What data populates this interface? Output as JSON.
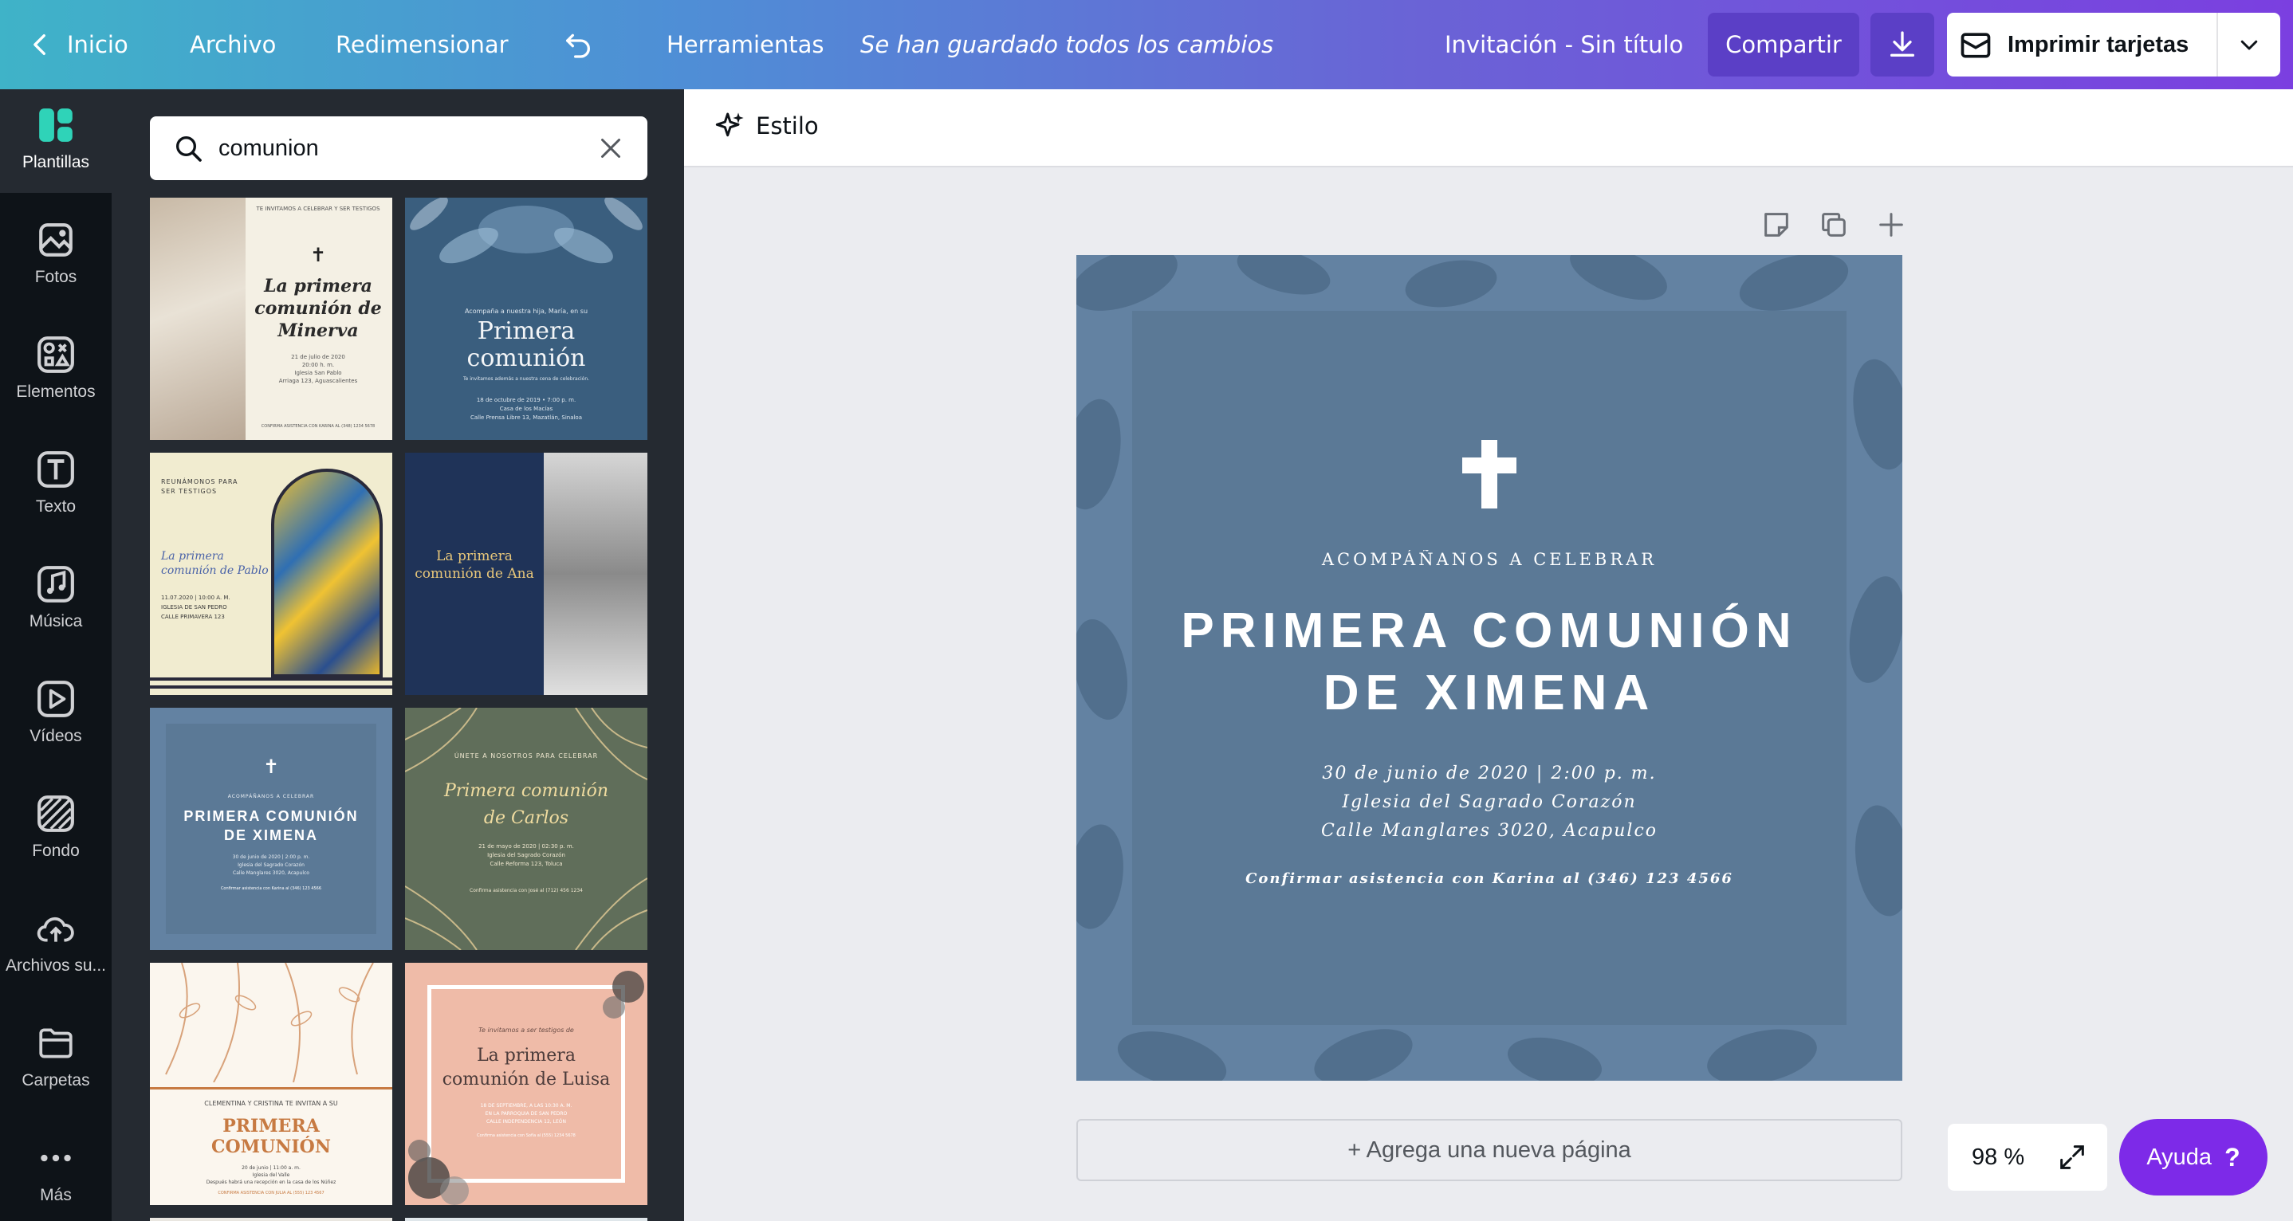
{
  "topbar": {
    "home": "Inicio",
    "file": "Archivo",
    "resize": "Redimensionar",
    "tools": "Herramientas",
    "saved_status": "Se han guardado todos los cambios",
    "doc_title": "Invitación - Sin título",
    "share": "Compartir",
    "print": "Imprimir tarjetas"
  },
  "rail": {
    "items": [
      {
        "label": "Plantillas",
        "icon": "templates-icon"
      },
      {
        "label": "Fotos",
        "icon": "photos-icon"
      },
      {
        "label": "Elementos",
        "icon": "elements-icon"
      },
      {
        "label": "Texto",
        "icon": "text-icon"
      },
      {
        "label": "Música",
        "icon": "music-icon"
      },
      {
        "label": "Vídeos",
        "icon": "video-icon"
      },
      {
        "label": "Fondo",
        "icon": "background-icon"
      },
      {
        "label": "Archivos su...",
        "icon": "uploads-icon"
      },
      {
        "label": "Carpetas",
        "icon": "folders-icon"
      },
      {
        "label": "Más",
        "icon": "more-icon"
      }
    ]
  },
  "search": {
    "value": "comunion"
  },
  "templates": [
    {
      "lines": [
        "TE INVITAMOS A CELEBRAR Y SER TESTIGOS",
        "La primera",
        "comunión de",
        "Minerva",
        "21 de julio de 2020",
        "20:00 h. m.",
        "Iglesia San Pablo",
        "Arriaga 123, Aguascalientes",
        "CONFIRMA ASISTENCIA CON KARINA AL (348) 1234 5678"
      ],
      "colors": {
        "bg": "#f4f0e4"
      }
    },
    {
      "lines": [
        "Acompaña a nuestra hija, María, en su",
        "Primera",
        "comunión",
        "Te invitamos además a nuestra cena de celebración.",
        "18 de octubre de 2019 • 7:00 p. m.",
        "Casa de los Macías",
        "Calle Prensa Libre 13, Mazatlán, Sinaloa"
      ],
      "colors": {
        "bg": "#3a5e7e"
      }
    },
    {
      "lines": [
        "REUNÁMONOS PARA",
        "SER TESTIGOS",
        "La primera",
        "comunión de Pablo",
        "11.07.2020 | 10:00 A. M.",
        "IGLESIA DE SAN PEDRO",
        "CALLE PRIMAVERA 123"
      ],
      "colors": {
        "bg": "#f1ecd0"
      }
    },
    {
      "lines": [
        "La primera",
        "comunión de Ana"
      ],
      "colors": {
        "bg": "#1f3358"
      }
    },
    {
      "lines": [
        "ACOMPÁÑANOS A CELEBRAR",
        "PRIMERA COMUNIÓN",
        "DE XIMENA",
        "30 de junio de 2020 | 2:00 p. m.",
        "Iglesia del Sagrado Corazón",
        "Calle Manglares 3020, Acapulco",
        "Confirmar asistencia con Karina al (346) 123 4566"
      ],
      "colors": {
        "bg": "#6382a2"
      }
    },
    {
      "lines": [
        "ÚNETE A NOSOTROS PARA CELEBRAR",
        "Primera comunión",
        "de Carlos",
        "21 de mayo de 2020 | 02:30 p. m.",
        "Iglesia del Sagrado Corazón",
        "Calle Reforma 123, Toluca",
        "Confirma asistencia con José al (712) 456 1234"
      ],
      "colors": {
        "bg": "#606e5a"
      }
    },
    {
      "lines": [
        "CLEMENTINA Y CRISTINA TE INVITAN A SU",
        "PRIMERA",
        "COMUNIÓN",
        "20 de junio | 11:00 a. m.",
        "Iglesia del Valle",
        "Después habrá una recepción en la casa de los Núñez",
        "CONFIRMA ASISTENCIA CON JULIA AL (555) 123 4567"
      ],
      "colors": {
        "bg": "#fbf6ee"
      }
    },
    {
      "lines": [
        "Te invitamos a ser testigos de",
        "La primera",
        "comunión de Luisa",
        "18 DE SEPTIEMBRE, A LAS 10:30 A. M.",
        "EN LA PARROQUIA DE SAN PEDRO",
        "CALLE INDEPENDENCIA 12, LEÓN",
        "Confirma asistencia con Sofía al (555) 1234 5678"
      ],
      "colors": {
        "bg": "#efbba8"
      }
    }
  ],
  "editor": {
    "style_label": "Estilo",
    "add_page": "+ Agrega una nueva página",
    "zoom": "98 %",
    "help": "Ayuda",
    "help_mark": "?"
  },
  "design": {
    "invite": "ACOMPÁÑANOS A CELEBRAR",
    "title_line1": "PRIMERA COMUNIÓN",
    "title_line2": "DE XIMENA",
    "date": "30 de junio de 2020 | 2:00 p. m.",
    "place": "Iglesia del Sagrado Corazón",
    "address": "Calle Manglares 3020, Acapulco",
    "rsvp": "Confirmar asistencia con Karina al (346) 123 4566",
    "colors": {
      "background": "#6382a2",
      "frame": "#5b7996",
      "leaf": "#526f8d",
      "text": "#ffffff"
    }
  },
  "theme": {
    "share_bg": "#5b3fc6",
    "help_bg": "#7d2ae8",
    "rail_bg": "#0e1318",
    "panel_bg": "#252a31"
  }
}
